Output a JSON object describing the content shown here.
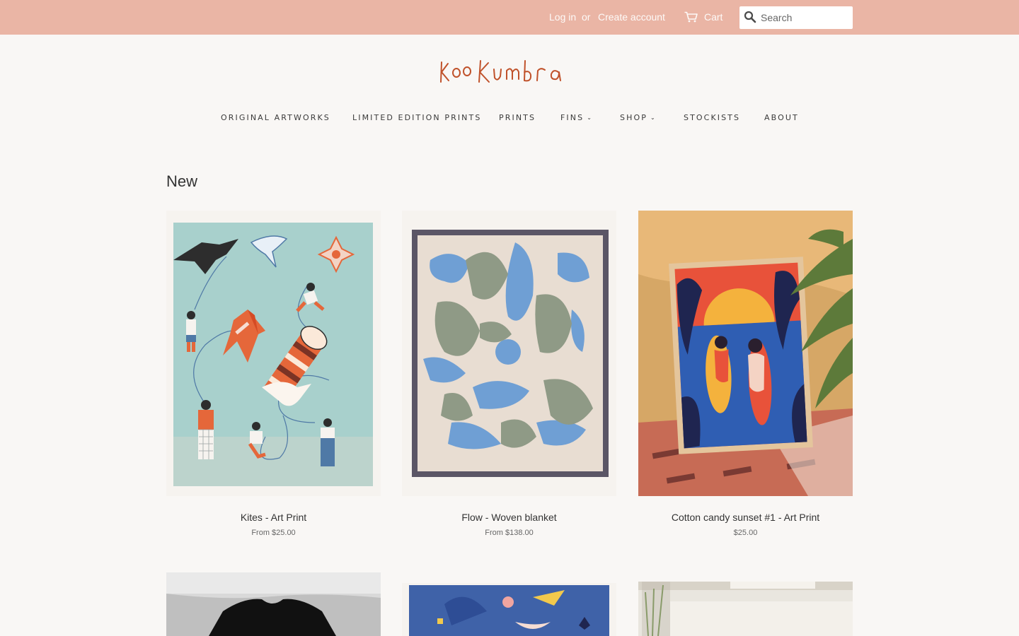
{
  "header": {
    "login_label": "Log in",
    "or_label": "or",
    "create_account_label": "Create account",
    "cart_label": "Cart",
    "search_placeholder": "Search",
    "cart_icon": "cart-icon",
    "search_icon": "search-icon"
  },
  "brand": {
    "logo_text": "KooKumbra",
    "logo_color": "#c0522b",
    "topbar_color": "#eab5a5"
  },
  "nav": {
    "items": [
      {
        "label": "ORIGINAL ARTWORKS"
      },
      {
        "label": "LIMITED EDITION PRINTS"
      },
      {
        "label": "PRINTS"
      },
      {
        "label": "FINS",
        "caret": "⌄"
      },
      {
        "label": "SHOP",
        "caret": "⌄"
      },
      {
        "label": "STOCKISTS"
      },
      {
        "label": "ABOUT"
      }
    ]
  },
  "collection": {
    "title": "New",
    "products": [
      {
        "title": "Kites - Art Print",
        "price": "From $25.00"
      },
      {
        "title": "Flow - Woven blanket",
        "price": "From $138.00"
      },
      {
        "title": "Cotton candy sunset #1 - Art Print",
        "price": "$25.00"
      }
    ]
  }
}
